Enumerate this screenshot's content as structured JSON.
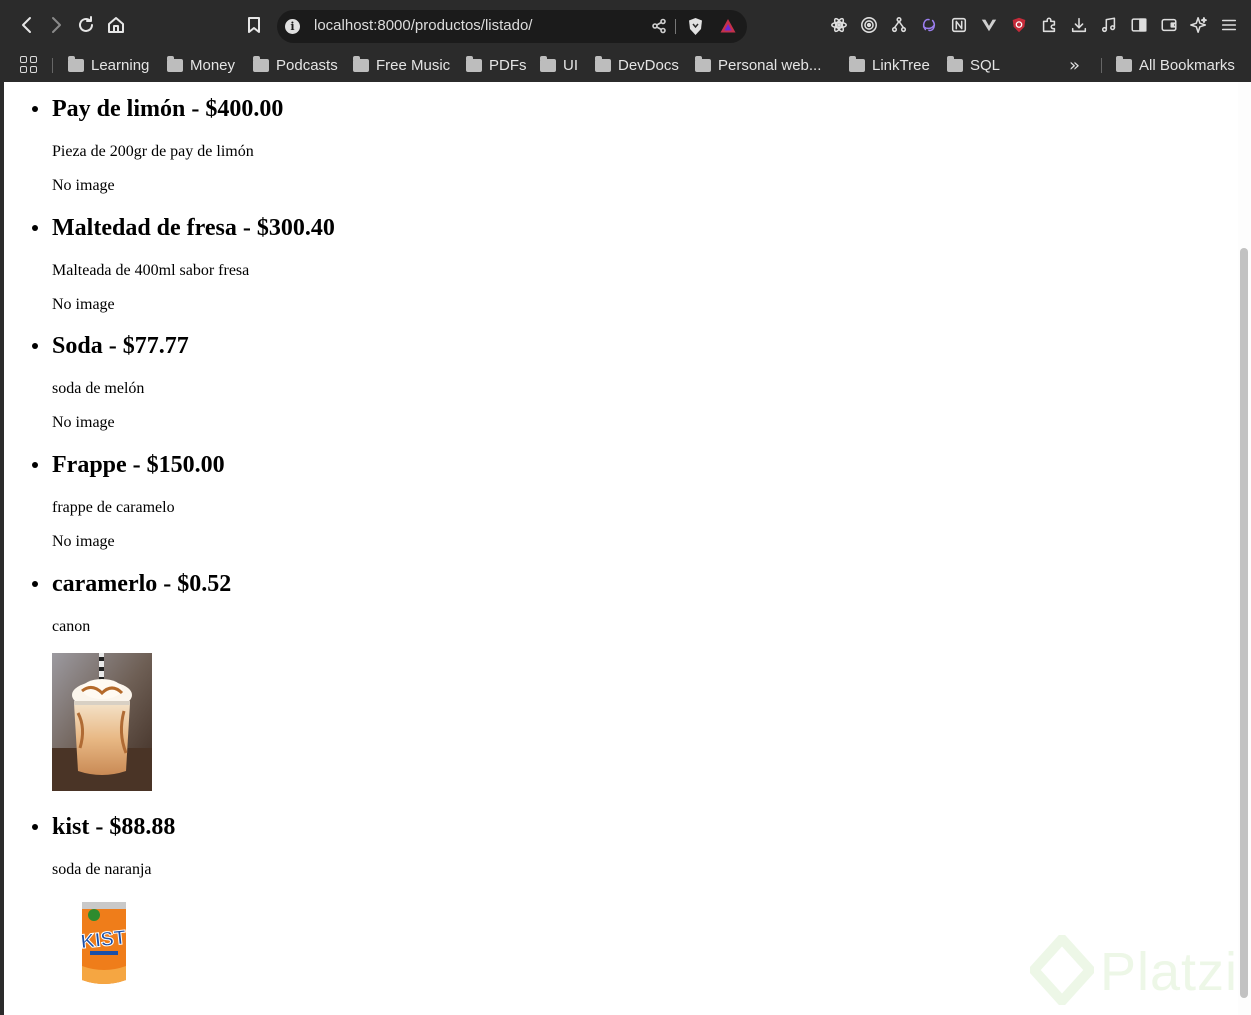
{
  "browser": {
    "url": "localhost:8000/productos/listado/",
    "bookmarks": [
      "Learning",
      "Money",
      "Podcasts",
      "Free Music",
      "PDFs",
      "UI",
      "DevDocs",
      "Personal web...",
      "LinkTree",
      "SQL"
    ],
    "all_bookmarks_label": "All Bookmarks",
    "overflow_label": "»"
  },
  "products": [
    {
      "title": "Pay de limón - $400.00",
      "description": "Pieza de 200gr de pay de limón",
      "image_text": "No image"
    },
    {
      "title": "Maltedad de fresa - $300.40",
      "description": "Malteada de 400ml sabor fresa",
      "image_text": "No image"
    },
    {
      "title": "Soda - $77.77",
      "description": "soda de melón",
      "image_text": "No image"
    },
    {
      "title": "Frappe - $150.00",
      "description": "frappe de caramelo",
      "image_text": "No image"
    },
    {
      "title": "caramerlo - $0.52",
      "description": "canon",
      "image": "caramel frappe photo"
    },
    {
      "title": "kist - $88.88",
      "description": "soda de naranja",
      "image": "Kist orange soda can"
    }
  ],
  "can_label": "KIST",
  "watermark": "Platzi"
}
